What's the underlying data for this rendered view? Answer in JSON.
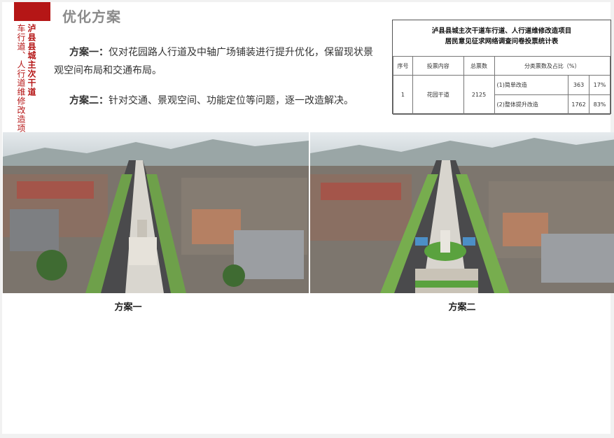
{
  "sidebar": {
    "red_bar_color": "#b51616",
    "vertical_title_bold": "泸县县城主次干道",
    "vertical_title_plain": "车行道、人行道维修改造项"
  },
  "page_title": "优化方案",
  "schemes": [
    {
      "label": "方案一：",
      "text": "仅对花园路人行道及中轴广场铺装进行提升优化，保留现状景观空间布局和交通布局。"
    },
    {
      "label": "方案二：",
      "text": "针对交通、景观空间、功能定位等问题，逐一改造解决。"
    }
  ],
  "stats_table": {
    "title_line1": "泸县县城主次干道车行道、人行道维修改造项目",
    "title_line2": "居民意见征求网络调查问卷投票统计表",
    "headers": [
      "序号",
      "投票内容",
      "总票数",
      "分类票数及占比（%）"
    ],
    "row": {
      "index": "1",
      "content": "花园干道",
      "total": "2125",
      "options": [
        {
          "name": "(1)简单改造",
          "votes": "363",
          "percent": "17%"
        },
        {
          "name": "(2)整体提升改造",
          "votes": "1762",
          "percent": "83%"
        }
      ]
    }
  },
  "images": [
    {
      "icon": "aerial-render-scheme-1-image",
      "caption": "方案一"
    },
    {
      "icon": "aerial-render-scheme-2-image",
      "caption": "方案二"
    }
  ]
}
